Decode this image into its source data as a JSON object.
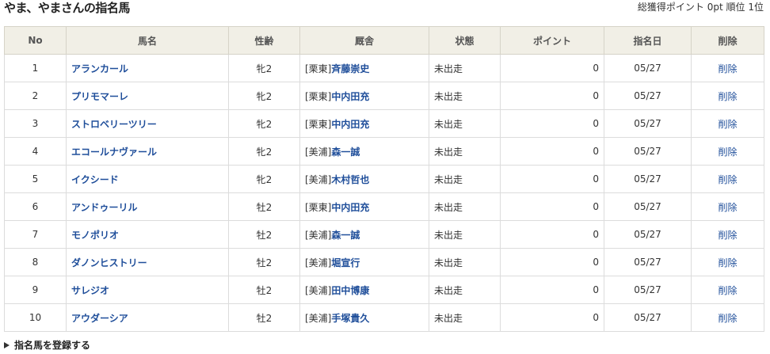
{
  "header": {
    "title": "やま、やまさんの指名馬",
    "points_label": "総獲得ポイント",
    "points_value": "0pt",
    "rank_label": "順位",
    "rank_value": "1位"
  },
  "table": {
    "columns": [
      "No",
      "馬名",
      "性齢",
      "厩舎",
      "状態",
      "ポイント",
      "指名日",
      "削除"
    ],
    "rows": [
      {
        "no": "1",
        "name": "アランカール",
        "sex_age": "牝2",
        "center": "[栗東]",
        "trainer": "斉藤崇史",
        "status": "未出走",
        "points": "0",
        "date": "05/27",
        "delete": "削除"
      },
      {
        "no": "2",
        "name": "プリモマーレ",
        "sex_age": "牝2",
        "center": "[栗東]",
        "trainer": "中内田充",
        "status": "未出走",
        "points": "0",
        "date": "05/27",
        "delete": "削除"
      },
      {
        "no": "3",
        "name": "ストロベリーツリー",
        "sex_age": "牝2",
        "center": "[栗東]",
        "trainer": "中内田充",
        "status": "未出走",
        "points": "0",
        "date": "05/27",
        "delete": "削除"
      },
      {
        "no": "4",
        "name": "エコールナヴァール",
        "sex_age": "牝2",
        "center": "[美浦]",
        "trainer": "森一誠",
        "status": "未出走",
        "points": "0",
        "date": "05/27",
        "delete": "削除"
      },
      {
        "no": "5",
        "name": "イクシード",
        "sex_age": "牝2",
        "center": "[美浦]",
        "trainer": "木村哲也",
        "status": "未出走",
        "points": "0",
        "date": "05/27",
        "delete": "削除"
      },
      {
        "no": "6",
        "name": "アンドゥーリル",
        "sex_age": "牡2",
        "center": "[栗東]",
        "trainer": "中内田充",
        "status": "未出走",
        "points": "0",
        "date": "05/27",
        "delete": "削除"
      },
      {
        "no": "7",
        "name": "モノポリオ",
        "sex_age": "牡2",
        "center": "[美浦]",
        "trainer": "森一誠",
        "status": "未出走",
        "points": "0",
        "date": "05/27",
        "delete": "削除"
      },
      {
        "no": "8",
        "name": "ダノンヒストリー",
        "sex_age": "牡2",
        "center": "[美浦]",
        "trainer": "堀宣行",
        "status": "未出走",
        "points": "0",
        "date": "05/27",
        "delete": "削除"
      },
      {
        "no": "9",
        "name": "サレジオ",
        "sex_age": "牡2",
        "center": "[美浦]",
        "trainer": "田中博康",
        "status": "未出走",
        "points": "0",
        "date": "05/27",
        "delete": "削除"
      },
      {
        "no": "10",
        "name": "アウダーシア",
        "sex_age": "牡2",
        "center": "[美浦]",
        "trainer": "手塚貴久",
        "status": "未出走",
        "points": "0",
        "date": "05/27",
        "delete": "削除"
      }
    ]
  },
  "footer": {
    "register_label": "指名馬を登録する"
  },
  "icons": {
    "register_toggle": "triangle-right-icon"
  }
}
